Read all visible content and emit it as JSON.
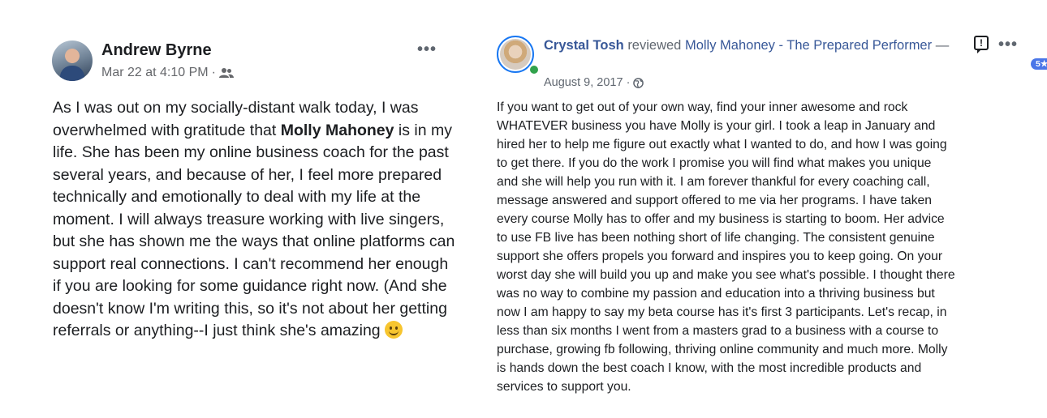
{
  "left_post": {
    "author": "Andrew Byrne",
    "timestamp": "Mar 22 at 4:10 PM",
    "separator": "·",
    "audience_icon": "friends-icon",
    "more_label": "•••",
    "body": {
      "part1": "As I was out on my socially-distant walk today, I was overwhelmed with gratitude that ",
      "bold_name": "Molly Mahoney",
      "part2": " is in my life. She has been my online business coach for the past several years, and because of her, I feel more prepared technically and emotionally to deal with my life at the moment. I will always treasure working with live singers, but she has shown me the ways that online platforms can support real connections. I can't recommend her enough if you are looking for some guidance right now. (And she doesn't know I'm writing this, so it's not about her getting referrals or anything--I just think she's amazing ",
      "emoji": "smiley-icon"
    }
  },
  "right_post": {
    "reviewer": "Crystal Tosh",
    "verb": "reviewed",
    "page_name": "Molly Mahoney - The Prepared Performer",
    "dash": "—",
    "report_label": "!",
    "more_label": "•••",
    "rating_badge": "5★",
    "date": "August 9, 2017 ·",
    "privacy_icon": "globe-icon",
    "body_lines": [
      "If you want to get out of your own way, find your inner awesome and rock",
      "WHATEVER business you have Molly is your girl. I took a leap in January and",
      "hired her to help me figure out exactly what I wanted to do, and how I was going",
      "to get there. If you do the work I promise you will find what makes you unique",
      "and she will help you run with it. I am forever thankful for every coaching call,",
      "message answered and support offered to me via her programs. I have taken",
      "every course Molly has to offer and my business is starting to boom. Her advice",
      "to use FB live has been nothing short of life changing. The consistent genuine",
      "support she offers propels you forward and inspires you to keep going. On your",
      "worst day she will build you up and make you see what's possible. I thought there",
      "was no way to combine my passion and education into a thriving business but",
      "now I am happy to say my beta course has it's first 3 participants. Let's recap, in",
      "less than six months I went from a masters grad to a business with a course to",
      "purchase, growing fb following, thriving online community and much more. Molly",
      "is hands down the best coach I know, with the most incredible products and",
      "services to support you."
    ]
  }
}
